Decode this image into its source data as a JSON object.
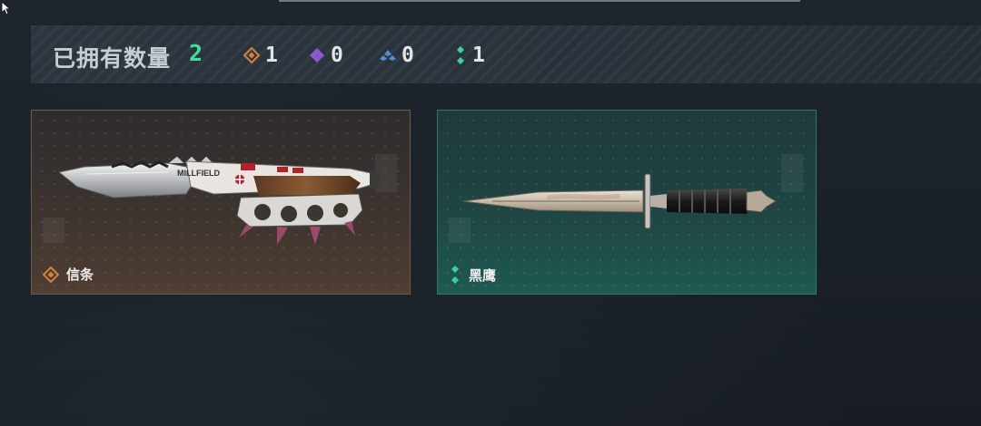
{
  "header": {
    "owned_label": "已拥有数量",
    "owned_total": "2",
    "total_color": "#3ee0a3"
  },
  "tallies": [
    {
      "icon": "orange-diamond-icon",
      "color": "#d5803f",
      "count": "1"
    },
    {
      "icon": "purple-diamond-icon",
      "color": "#8c5bd1",
      "count": "0"
    },
    {
      "icon": "blue-triangle-icon",
      "color": "#4a90d9",
      "count": "0"
    },
    {
      "icon": "green-dots-icon",
      "color": "#3ccfa0",
      "count": "1"
    }
  ],
  "items": [
    {
      "name": "信条",
      "rarity_icon": "orange-diamond-icon",
      "rarity_color": "#d5803f",
      "engraving": "MILLFIELD"
    },
    {
      "name": "黑鹰",
      "rarity_icon": "green-dots-icon",
      "rarity_color": "#3ccfa0"
    }
  ]
}
